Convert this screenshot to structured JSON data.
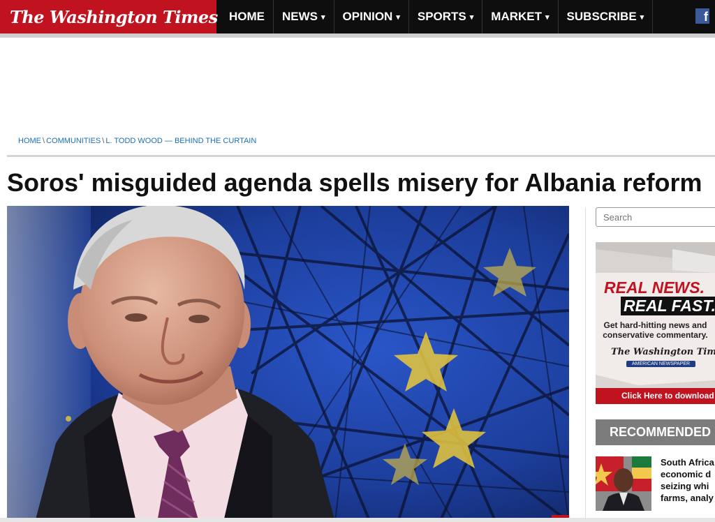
{
  "site": {
    "name": "The Washington Times"
  },
  "nav": {
    "items": [
      {
        "label": "HOME",
        "caret": ""
      },
      {
        "label": "NEWS",
        "caret": "▾"
      },
      {
        "label": "OPINION",
        "caret": "▾"
      },
      {
        "label": "SPORTS",
        "caret": "▾"
      },
      {
        "label": "MARKET",
        "caret": "▾"
      },
      {
        "label": "SUBSCRIBE",
        "caret": "▾"
      }
    ],
    "facebook_icon": "f"
  },
  "breadcrumb": {
    "items": [
      "HOME",
      "COMMUNITIES",
      "L. TODD WOOD — BEHIND THE CURTAIN"
    ],
    "separator": "\\"
  },
  "article": {
    "headline": "Soros' misguided agenda spells misery for Albania reform"
  },
  "sidebar": {
    "search_placeholder": "Search",
    "ad": {
      "line1": "REAL NEWS.",
      "line2": "REAL FAST.",
      "sub1": "Get hard-hitting news and",
      "sub2": "conservative commentary.",
      "logo": "The Washington Times",
      "ribbon": "AMERICAN NEWSPAPER",
      "cta": "Click Here to download our app"
    },
    "recommended": {
      "header": "RECOMMENDED",
      "item": {
        "lines": [
          "South Africa",
          "economic d",
          "seizing whi",
          "farms, analy"
        ]
      }
    }
  },
  "colors": {
    "brand_red": "#c1131f",
    "nav_bg": "#0e0e0e",
    "link_blue": "#1a6fb5",
    "facebook_blue": "#3b5998",
    "recommended_bg": "#7c7c7c"
  }
}
